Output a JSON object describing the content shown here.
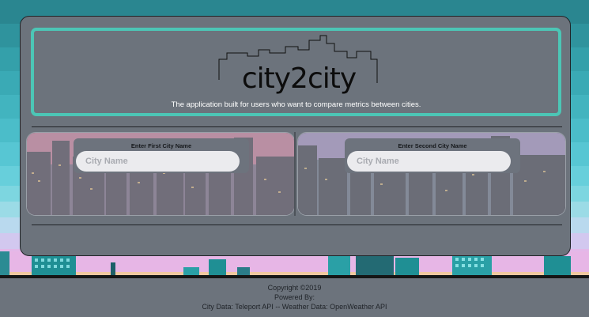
{
  "header": {
    "logo_text": "city2city",
    "tagline": "The application built for users who want to compare metrics between cities."
  },
  "search": {
    "first_label": "Enter First City Name",
    "first_placeholder": "City Name",
    "first_value": "",
    "second_label": "Enter Second City Name",
    "second_placeholder": "City Name",
    "second_value": ""
  },
  "footer": {
    "copyright": "Copyright ©2019",
    "powered_by": "Powered By:",
    "sources": "City Data: Teleport API -- Weather Data: OpenWeather API"
  },
  "colors": {
    "card": "#6c737c",
    "accent_border": "#4cc6b6",
    "input_bg": "#ebebee"
  }
}
